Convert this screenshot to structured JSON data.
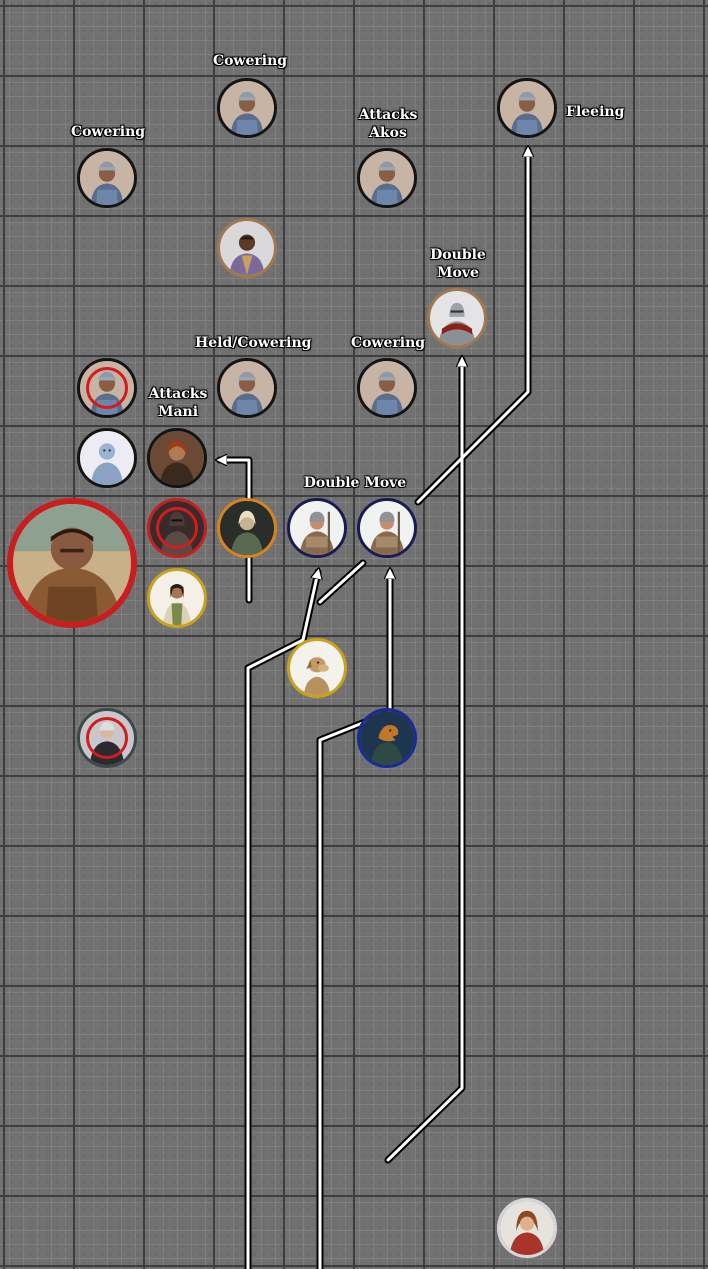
{
  "labels": {
    "cowering_top": "Cowering",
    "cowering_left": "Cowering",
    "attacks_akos": "Attacks\nAkos",
    "fleeing": "Fleeing",
    "double_move_top": "Double\nMove",
    "held_cowering": "Held/Cowering",
    "cowering_mid": "Cowering",
    "attacks_mani": "Attacks\nMani",
    "double_move_mid": "Double Move"
  },
  "token_border_colors": {
    "dark": "#141414",
    "tan": "#a07a4c",
    "red": "#c81e1e",
    "orange": "#d9831e",
    "navy": "#1a1a55",
    "gold": "#c9a21a",
    "blue": "#1b2a9a",
    "gray": "#3a4a4a",
    "light": "#d6d6d6"
  },
  "tokens": [
    {
      "name": "guard-token-cowering-top",
      "art": "guard",
      "border": "dark"
    },
    {
      "name": "guard-token-cowering-left",
      "art": "guard",
      "border": "dark"
    },
    {
      "name": "guard-token-attacks-akos",
      "art": "guard",
      "border": "dark"
    },
    {
      "name": "guard-token-fleeing",
      "art": "guard",
      "border": "dark"
    },
    {
      "name": "noble-token",
      "art": "noble",
      "border": "tan"
    },
    {
      "name": "knight-token-double-move",
      "art": "knight",
      "border": "tan"
    },
    {
      "name": "guard-token-marked",
      "art": "guard",
      "border": "dark"
    },
    {
      "name": "guard-token-held-cowering",
      "art": "guard",
      "border": "dark"
    },
    {
      "name": "guard-token-cowering-mid",
      "art": "guard",
      "border": "dark"
    },
    {
      "name": "pale-creature-token",
      "art": "pale",
      "border": "dark"
    },
    {
      "name": "rogue-token-attacks-mani",
      "art": "rogue",
      "border": "dark"
    },
    {
      "name": "ogre-boss-token",
      "art": "ogre",
      "border": "red"
    },
    {
      "name": "dark-warrior-token",
      "art": "darkwarrior",
      "border": "red"
    },
    {
      "name": "elf-warrior-token",
      "art": "elf",
      "border": "orange"
    },
    {
      "name": "soldier-token-a",
      "art": "soldier",
      "border": "navy"
    },
    {
      "name": "soldier-token-b",
      "art": "soldier",
      "border": "navy"
    },
    {
      "name": "ranger-token",
      "art": "ranger",
      "border": "gold"
    },
    {
      "name": "dog-token",
      "art": "dog",
      "border": "gold"
    },
    {
      "name": "armored-token-marked",
      "art": "armored",
      "border": "gray"
    },
    {
      "name": "lizardfolk-token",
      "art": "lizard",
      "border": "blue"
    },
    {
      "name": "woman-token",
      "art": "woman",
      "border": "light"
    }
  ]
}
